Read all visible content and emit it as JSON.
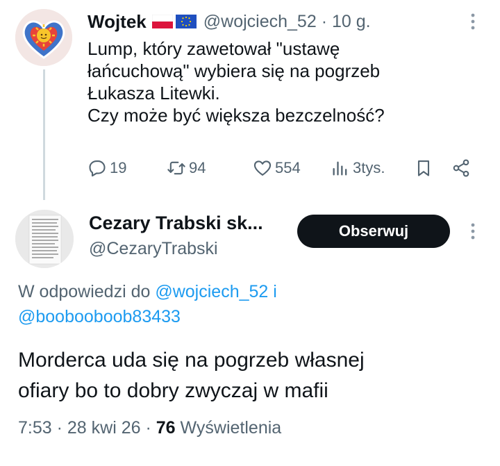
{
  "parent_tweet": {
    "author_name": "Wojtek",
    "handle": "@wojciech_52",
    "separator": "·",
    "time_ago": "10 g.",
    "flag_icons": [
      "poland-flag-icon",
      "eu-flag-icon"
    ],
    "text_lines": [
      "Lump, który zawetował \"ustawę",
      "łańcuchową\" wybiera się na pogrzeb",
      "Łukasza Litewki.",
      "Czy może być większa bezczelność?"
    ],
    "stats": {
      "replies": "19",
      "reposts": "94",
      "likes": "554",
      "views": "3tys."
    }
  },
  "reply": {
    "author_name": "Cezary Trabski sk...",
    "handle": "@CezaryTrabski",
    "follow_label": "Obserwuj",
    "replying_prefix": "W odpowiedzi do",
    "mention_1": "@wojciech_52",
    "conjunction": "i",
    "mention_2": "@boobooboob83433",
    "text_lines": [
      "Morderca uda się na pogrzeb własnej",
      "ofiary bo to dobry zwyczaj w mafii"
    ],
    "time": "7:53",
    "separator": "·",
    "date": "28 kwi 26",
    "views_count": "76",
    "views_label": "Wyświetlenia"
  },
  "colors": {
    "text_primary": "#0f1419",
    "text_secondary": "#536471",
    "link": "#1d9bf0",
    "thread_line": "#cfd9de",
    "follow_button_bg": "#0f1419"
  }
}
